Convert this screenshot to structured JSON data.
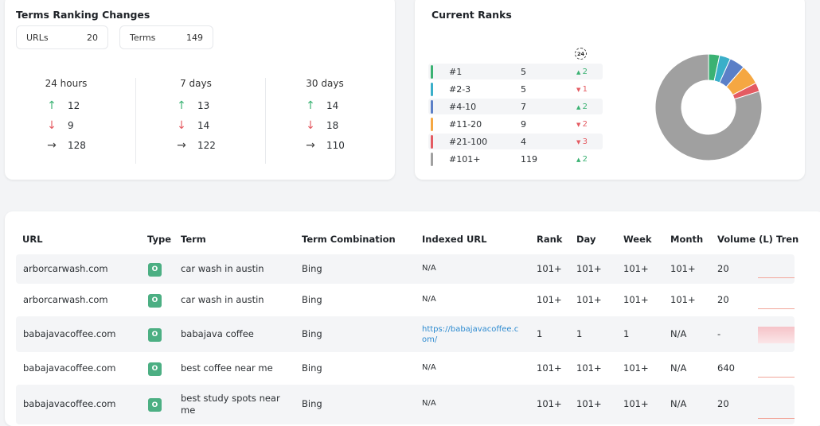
{
  "terms_card": {
    "title": "Terms Ranking Changes",
    "urls_label": "URLs",
    "urls_value": "20",
    "terms_label": "Terms",
    "terms_value": "149",
    "periods": [
      {
        "label": "24 hours",
        "up": "12",
        "down": "9",
        "flat": "128"
      },
      {
        "label": "7 days",
        "up": "13",
        "down": "14",
        "flat": "122"
      },
      {
        "label": "30 days",
        "up": "14",
        "down": "18",
        "flat": "110"
      }
    ]
  },
  "ranks_card": {
    "title": "Current Ranks",
    "icon_label": "24",
    "rows": [
      {
        "label": "#1",
        "count": "5",
        "dir": "up",
        "delta": "2",
        "color": "#3bb273"
      },
      {
        "label": "#2-3",
        "count": "5",
        "dir": "down",
        "delta": "1",
        "color": "#3aafc9"
      },
      {
        "label": "#4-10",
        "count": "7",
        "dir": "up",
        "delta": "2",
        "color": "#5b7fc7"
      },
      {
        "label": "#11-20",
        "count": "9",
        "dir": "down",
        "delta": "2",
        "color": "#f5a742"
      },
      {
        "label": "#21-100",
        "count": "4",
        "dir": "down",
        "delta": "3",
        "color": "#e45b62"
      },
      {
        "label": "#101+",
        "count": "119",
        "dir": "up",
        "delta": "2",
        "color": "#a0a0a0"
      }
    ],
    "up_symbol": "▲",
    "down_symbol": "▼"
  },
  "table": {
    "headers": {
      "url": "URL",
      "type": "Type",
      "term": "Term",
      "combo": "Term Combination",
      "indexed": "Indexed URL",
      "rank": "Rank",
      "day": "Day",
      "week": "Week",
      "month": "Month",
      "volume": "Volume (L)",
      "trend": "Tren"
    },
    "rows": [
      {
        "url": "arborcarwash.com",
        "type": "O",
        "term": "car wash in austin",
        "combo": "Bing",
        "indexed": "N/A",
        "rank": "101+",
        "day": "101+",
        "week": "101+",
        "month": "101+",
        "volume": "20"
      },
      {
        "url": "arborcarwash.com",
        "type": "O",
        "term": "car wash in austin",
        "combo": "Bing",
        "indexed": "N/A",
        "rank": "101+",
        "day": "101+",
        "week": "101+",
        "month": "101+",
        "volume": "20"
      },
      {
        "url": "babajavacoffee.com",
        "type": "O",
        "term": "babajava coffee",
        "combo": "Bing",
        "indexed": "https://babajavacoffee.com/",
        "rank": "1",
        "day": "1",
        "week": "1",
        "month": "N/A",
        "volume": "-"
      },
      {
        "url": "babajavacoffee.com",
        "type": "O",
        "term": "best coffee near me",
        "combo": "Bing",
        "indexed": "N/A",
        "rank": "101+",
        "day": "101+",
        "week": "101+",
        "month": "N/A",
        "volume": "640"
      },
      {
        "url": "babajavacoffee.com",
        "type": "O",
        "term": "best study spots near me",
        "combo": "Bing",
        "indexed": "N/A",
        "rank": "101+",
        "day": "101+",
        "week": "101+",
        "month": "N/A",
        "volume": "20"
      }
    ]
  }
}
